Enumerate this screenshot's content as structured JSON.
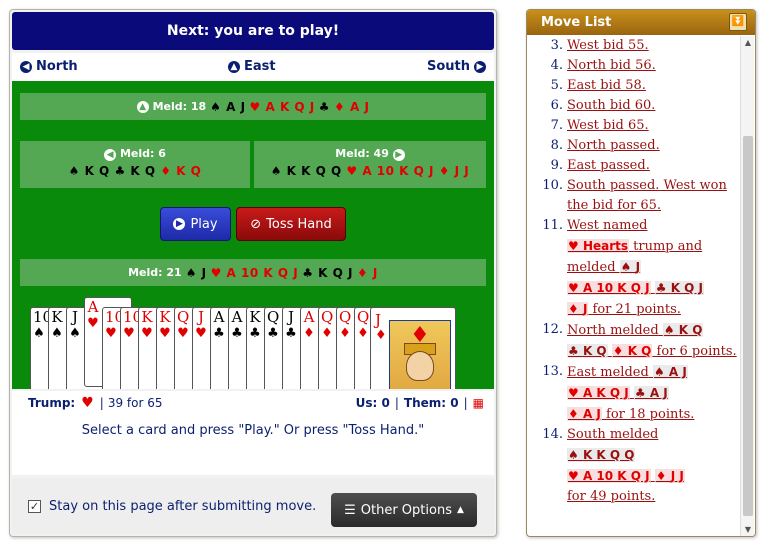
{
  "game": {
    "header": "Next: you are to play!",
    "directions": {
      "left": "North",
      "center": "East",
      "right": "South"
    },
    "melds": {
      "top": {
        "label": "Meld: 18",
        "spades": "A J",
        "hearts": "A K Q J",
        "clubs": "",
        "diamonds": "A J"
      },
      "left": {
        "label": "Meld: 6",
        "spades": "K Q",
        "clubs": "K Q",
        "diamonds": "K Q"
      },
      "right": {
        "label": "Meld: 49",
        "spades": "K K Q Q",
        "hearts": "A 10 K Q J",
        "diamonds": "J J"
      },
      "bottom": {
        "label": "Meld: 21",
        "spades": "J",
        "hearts": "A 10 K Q J",
        "clubs": "K Q J",
        "diamonds": "J"
      }
    },
    "buttons": {
      "play": "Play",
      "toss": "Toss Hand"
    },
    "hand": [
      {
        "rank": "10",
        "suit": "♠",
        "color": "black"
      },
      {
        "rank": "K",
        "suit": "♠",
        "color": "black"
      },
      {
        "rank": "J",
        "suit": "♠",
        "color": "black"
      },
      {
        "rank": "A",
        "suit": "♥",
        "color": "red"
      },
      {
        "rank": "10",
        "suit": "♥",
        "color": "red"
      },
      {
        "rank": "10",
        "suit": "♥",
        "color": "red"
      },
      {
        "rank": "K",
        "suit": "♥",
        "color": "red"
      },
      {
        "rank": "K",
        "suit": "♥",
        "color": "red"
      },
      {
        "rank": "Q",
        "suit": "♥",
        "color": "red"
      },
      {
        "rank": "J",
        "suit": "♥",
        "color": "red"
      },
      {
        "rank": "A",
        "suit": "♣",
        "color": "black"
      },
      {
        "rank": "A",
        "suit": "♣",
        "color": "black"
      },
      {
        "rank": "K",
        "suit": "♣",
        "color": "black"
      },
      {
        "rank": "Q",
        "suit": "♣",
        "color": "black"
      },
      {
        "rank": "J",
        "suit": "♣",
        "color": "black"
      },
      {
        "rank": "A",
        "suit": "♦",
        "color": "red"
      },
      {
        "rank": "Q",
        "suit": "♦",
        "color": "red"
      },
      {
        "rank": "Q",
        "suit": "♦",
        "color": "red"
      },
      {
        "rank": "Q",
        "suit": "♦",
        "color": "red"
      },
      {
        "rank": "J",
        "suit": "♦",
        "color": "red"
      }
    ],
    "status": {
      "trump_label": "Trump:",
      "bid": "39 for 65",
      "us": "Us: 0",
      "them": "Them: 0"
    },
    "instructions": "Select a card and press \"Play.\" Or press \"Toss Hand.\"",
    "stay_label": "Stay on this page after submitting move.",
    "other_options": "Other Options"
  },
  "move_list": {
    "title": "Move List",
    "items": [
      {
        "n": "3.",
        "text": "West bid 55."
      },
      {
        "n": "4.",
        "text": "North bid 56."
      },
      {
        "n": "5.",
        "text": "East bid 58."
      },
      {
        "n": "6.",
        "text": "South bid 60."
      },
      {
        "n": "7.",
        "text": "West bid 65."
      },
      {
        "n": "8.",
        "text": "North passed."
      },
      {
        "n": "9.",
        "text": "East passed."
      },
      {
        "n": "10.",
        "text": "South passed. West won the bid for 65."
      },
      {
        "n": "11.",
        "text": "West named",
        "trump": "Hearts",
        "text2": "trump and melded",
        "c1": "J",
        "c2": "A 10 K Q J",
        "c3": "K Q J",
        "c4": "J",
        "end": "for 21 points."
      },
      {
        "n": "12.",
        "text": "North melded",
        "c1": "K Q",
        "c2": "K Q",
        "c3": "K Q",
        "end": "for 6 points."
      },
      {
        "n": "13.",
        "text": "East melded",
        "c1": "A J",
        "c2": "A K Q J",
        "c3": "A J",
        "c4": "A J",
        "end": "for 18 points."
      },
      {
        "n": "14.",
        "text": "South melded",
        "c1": "K K Q Q",
        "c2": "A 10 K Q J",
        "c3": "J J",
        "end": "for 49 points."
      }
    ]
  }
}
